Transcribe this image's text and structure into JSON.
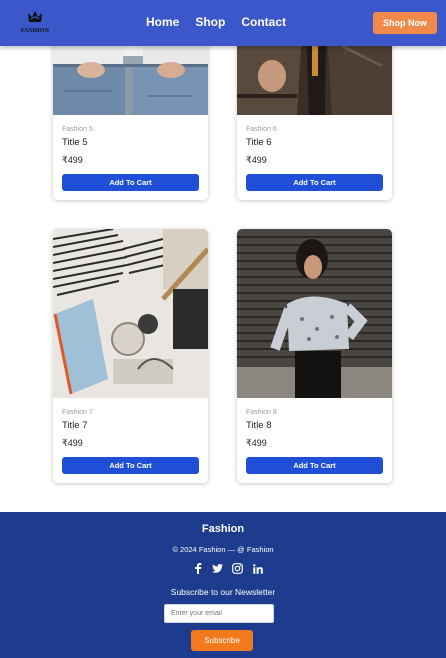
{
  "header": {
    "logo_text": "FASHION",
    "nav": [
      "Home",
      "Shop",
      "Contact"
    ],
    "cta_label": "Shop Now"
  },
  "products": [
    {
      "category": "Fashion 5",
      "title": "Title 5",
      "price": "₹499",
      "button": "Add To Cart",
      "image": "denim-couple-photo"
    },
    {
      "category": "Fashion 6",
      "title": "Title 6",
      "price": "₹499",
      "button": "Add To Cart",
      "image": "tweed-jacket-photo"
    },
    {
      "category": "Fashion 7",
      "title": "Title 7",
      "price": "₹499",
      "button": "Add To Cart",
      "image": "flatlay-photo"
    },
    {
      "category": "Fashion 8",
      "title": "Title 8",
      "price": "₹499",
      "button": "Add To Cart",
      "image": "woman-sweater-photo"
    }
  ],
  "footer": {
    "brand": "Fashion",
    "copyright": "© 2024 Fashion — @ Fashion",
    "socials": [
      "facebook-icon",
      "twitter-icon",
      "instagram-icon",
      "linkedin-icon"
    ],
    "newsletter_heading": "Subscribe to our Newsletter",
    "email_placeholder": "Enter your email",
    "subscribe_label": "Subscribe"
  },
  "colors": {
    "header_bg": "#3b57c9",
    "cta": "#f08a4b",
    "cart_button": "#1f4fd6",
    "footer_bg": "#1e3c8d",
    "subscribe": "#f27a1c"
  }
}
